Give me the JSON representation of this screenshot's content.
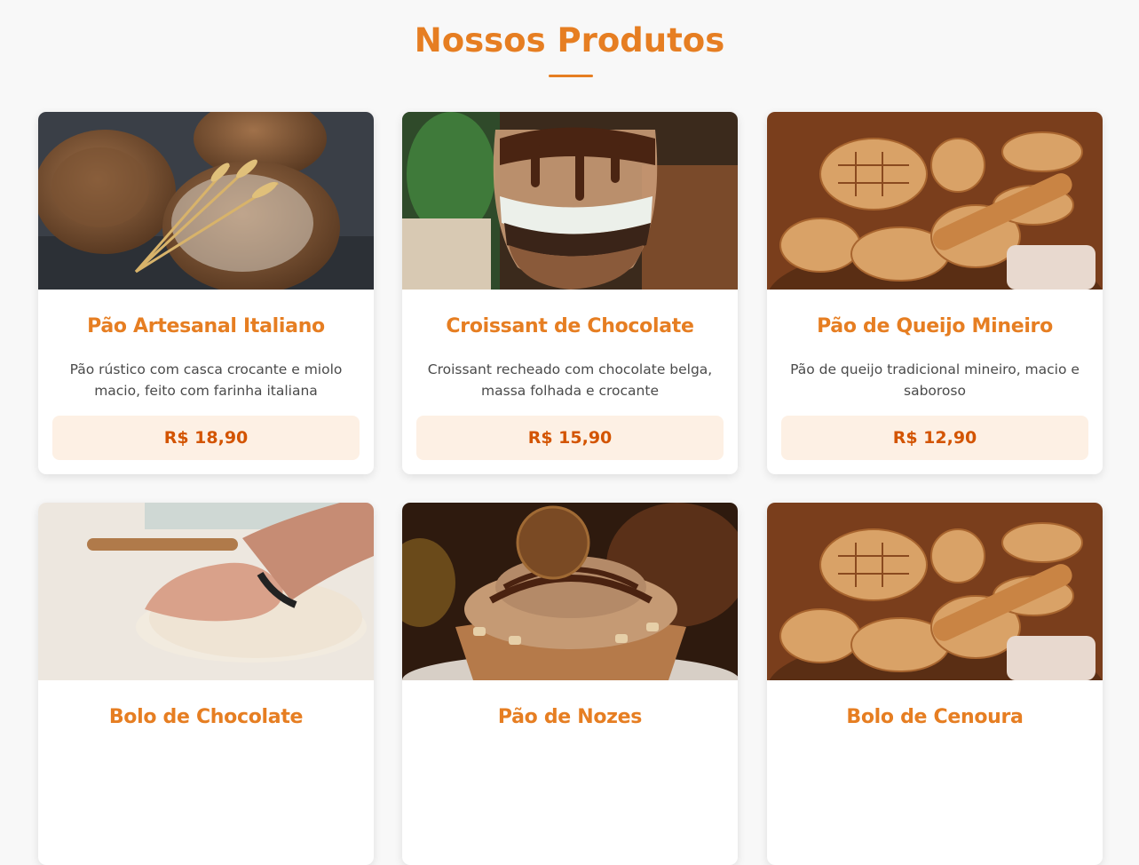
{
  "section": {
    "title": "Nossos Produtos"
  },
  "colors": {
    "accent": "#e67e22",
    "price_text": "#d35400",
    "price_bg": "#fdf0e4",
    "background": "#f8f8f8"
  },
  "products": [
    {
      "name": "Pão Artesanal Italiano",
      "description": "Pão rústico com casca crocante e miolo macio, feito com farinha italiana",
      "price": "R$ 18,90",
      "image": "rustic-bread-with-wheat-photo"
    },
    {
      "name": "Croissant de Chocolate",
      "description": "Croissant recheado com chocolate belga, massa folhada e crocante",
      "price": "R$ 15,90",
      "image": "chocolate-dessert-glass-photo"
    },
    {
      "name": "Pão de Queijo Mineiro",
      "description": "Pão de queijo tradicional mineiro, macio e saboroso",
      "price": "R$ 12,90",
      "image": "bread-basket-photo"
    },
    {
      "name": "Bolo de Chocolate",
      "image": "kneading-dough-photo"
    },
    {
      "name": "Pão de Nozes",
      "image": "chocolate-cupcake-photo"
    },
    {
      "name": "Bolo de Cenoura",
      "image": "bread-basket-photo"
    }
  ]
}
